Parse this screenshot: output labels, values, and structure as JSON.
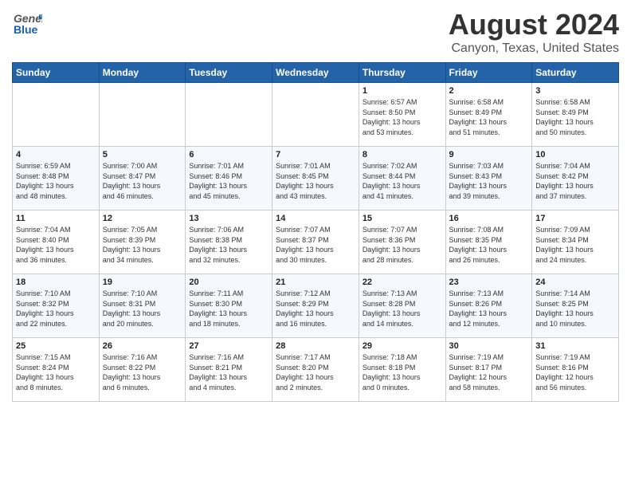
{
  "header": {
    "logo_general": "General",
    "logo_blue": "Blue",
    "main_title": "August 2024",
    "subtitle": "Canyon, Texas, United States"
  },
  "calendar": {
    "days_of_week": [
      "Sunday",
      "Monday",
      "Tuesday",
      "Wednesday",
      "Thursday",
      "Friday",
      "Saturday"
    ],
    "weeks": [
      [
        {
          "day": "",
          "info": ""
        },
        {
          "day": "",
          "info": ""
        },
        {
          "day": "",
          "info": ""
        },
        {
          "day": "",
          "info": ""
        },
        {
          "day": "1",
          "info": "Sunrise: 6:57 AM\nSunset: 8:50 PM\nDaylight: 13 hours\nand 53 minutes."
        },
        {
          "day": "2",
          "info": "Sunrise: 6:58 AM\nSunset: 8:49 PM\nDaylight: 13 hours\nand 51 minutes."
        },
        {
          "day": "3",
          "info": "Sunrise: 6:58 AM\nSunset: 8:49 PM\nDaylight: 13 hours\nand 50 minutes."
        }
      ],
      [
        {
          "day": "4",
          "info": "Sunrise: 6:59 AM\nSunset: 8:48 PM\nDaylight: 13 hours\nand 48 minutes."
        },
        {
          "day": "5",
          "info": "Sunrise: 7:00 AM\nSunset: 8:47 PM\nDaylight: 13 hours\nand 46 minutes."
        },
        {
          "day": "6",
          "info": "Sunrise: 7:01 AM\nSunset: 8:46 PM\nDaylight: 13 hours\nand 45 minutes."
        },
        {
          "day": "7",
          "info": "Sunrise: 7:01 AM\nSunset: 8:45 PM\nDaylight: 13 hours\nand 43 minutes."
        },
        {
          "day": "8",
          "info": "Sunrise: 7:02 AM\nSunset: 8:44 PM\nDaylight: 13 hours\nand 41 minutes."
        },
        {
          "day": "9",
          "info": "Sunrise: 7:03 AM\nSunset: 8:43 PM\nDaylight: 13 hours\nand 39 minutes."
        },
        {
          "day": "10",
          "info": "Sunrise: 7:04 AM\nSunset: 8:42 PM\nDaylight: 13 hours\nand 37 minutes."
        }
      ],
      [
        {
          "day": "11",
          "info": "Sunrise: 7:04 AM\nSunset: 8:40 PM\nDaylight: 13 hours\nand 36 minutes."
        },
        {
          "day": "12",
          "info": "Sunrise: 7:05 AM\nSunset: 8:39 PM\nDaylight: 13 hours\nand 34 minutes."
        },
        {
          "day": "13",
          "info": "Sunrise: 7:06 AM\nSunset: 8:38 PM\nDaylight: 13 hours\nand 32 minutes."
        },
        {
          "day": "14",
          "info": "Sunrise: 7:07 AM\nSunset: 8:37 PM\nDaylight: 13 hours\nand 30 minutes."
        },
        {
          "day": "15",
          "info": "Sunrise: 7:07 AM\nSunset: 8:36 PM\nDaylight: 13 hours\nand 28 minutes."
        },
        {
          "day": "16",
          "info": "Sunrise: 7:08 AM\nSunset: 8:35 PM\nDaylight: 13 hours\nand 26 minutes."
        },
        {
          "day": "17",
          "info": "Sunrise: 7:09 AM\nSunset: 8:34 PM\nDaylight: 13 hours\nand 24 minutes."
        }
      ],
      [
        {
          "day": "18",
          "info": "Sunrise: 7:10 AM\nSunset: 8:32 PM\nDaylight: 13 hours\nand 22 minutes."
        },
        {
          "day": "19",
          "info": "Sunrise: 7:10 AM\nSunset: 8:31 PM\nDaylight: 13 hours\nand 20 minutes."
        },
        {
          "day": "20",
          "info": "Sunrise: 7:11 AM\nSunset: 8:30 PM\nDaylight: 13 hours\nand 18 minutes."
        },
        {
          "day": "21",
          "info": "Sunrise: 7:12 AM\nSunset: 8:29 PM\nDaylight: 13 hours\nand 16 minutes."
        },
        {
          "day": "22",
          "info": "Sunrise: 7:13 AM\nSunset: 8:28 PM\nDaylight: 13 hours\nand 14 minutes."
        },
        {
          "day": "23",
          "info": "Sunrise: 7:13 AM\nSunset: 8:26 PM\nDaylight: 13 hours\nand 12 minutes."
        },
        {
          "day": "24",
          "info": "Sunrise: 7:14 AM\nSunset: 8:25 PM\nDaylight: 13 hours\nand 10 minutes."
        }
      ],
      [
        {
          "day": "25",
          "info": "Sunrise: 7:15 AM\nSunset: 8:24 PM\nDaylight: 13 hours\nand 8 minutes."
        },
        {
          "day": "26",
          "info": "Sunrise: 7:16 AM\nSunset: 8:22 PM\nDaylight: 13 hours\nand 6 minutes."
        },
        {
          "day": "27",
          "info": "Sunrise: 7:16 AM\nSunset: 8:21 PM\nDaylight: 13 hours\nand 4 minutes."
        },
        {
          "day": "28",
          "info": "Sunrise: 7:17 AM\nSunset: 8:20 PM\nDaylight: 13 hours\nand 2 minutes."
        },
        {
          "day": "29",
          "info": "Sunrise: 7:18 AM\nSunset: 8:18 PM\nDaylight: 13 hours\nand 0 minutes."
        },
        {
          "day": "30",
          "info": "Sunrise: 7:19 AM\nSunset: 8:17 PM\nDaylight: 12 hours\nand 58 minutes."
        },
        {
          "day": "31",
          "info": "Sunrise: 7:19 AM\nSunset: 8:16 PM\nDaylight: 12 hours\nand 56 minutes."
        }
      ]
    ]
  }
}
